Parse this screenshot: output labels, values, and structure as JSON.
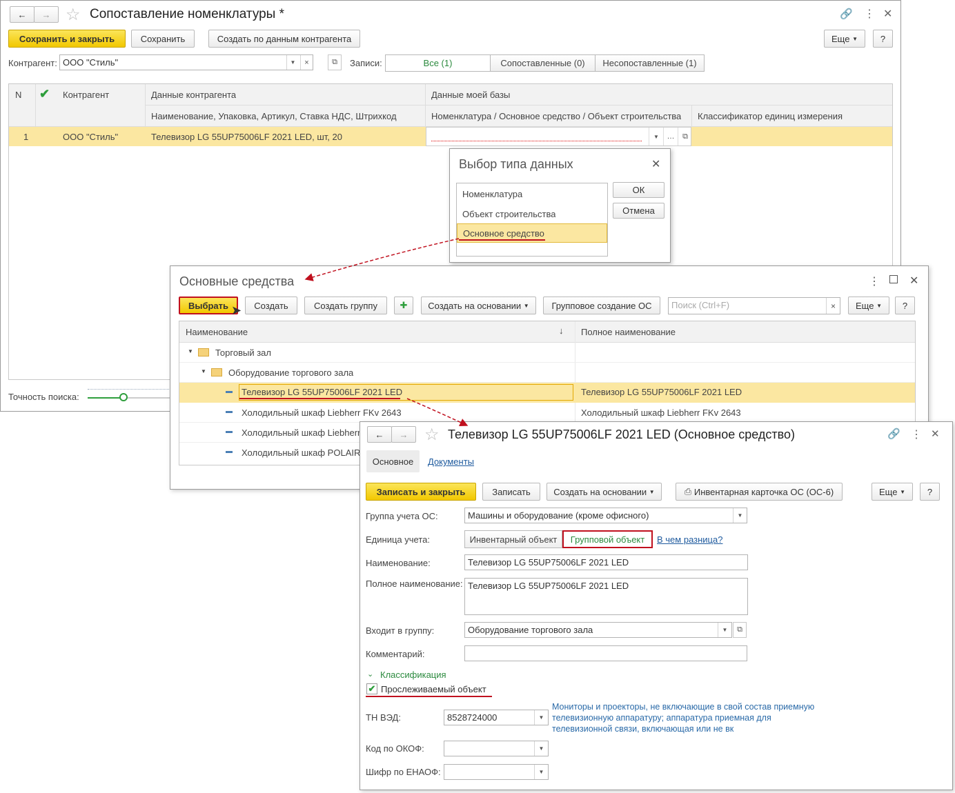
{
  "w1": {
    "title": "Сопоставление номенклатуры *",
    "btn_save_close": "Сохранить и закрыть",
    "btn_save": "Сохранить",
    "btn_create_by": "Создать по данным контрагента",
    "btn_more": "Еще",
    "btn_help": "?",
    "counterparty_label": "Контрагент:",
    "counterparty_value": "ООО \"Стиль\"",
    "records_label": "Записи:",
    "filter_all": "Все (1)",
    "filter_matched": "Сопоставленные (0)",
    "filter_unmatched": "Несопоставленные (1)",
    "grid": {
      "col_n": "N",
      "col_counterparty": "Контрагент",
      "col_cp_data": "Данные контрагента",
      "col_cp_sub": "Наименование, Упаковка, Артикул, Ставка НДС, Штрихкод",
      "col_my_data": "Данные моей базы",
      "col_my_sub": "Номенклатура / Основное средство / Объект строительства",
      "col_unit": "Классификатор единиц измерения",
      "row_n": "1",
      "row_cp": "ООО \"Стиль\"",
      "row_cp_data": "Телевизор LG 55UP75006LF 2021 LED, шт, 20"
    },
    "search_precision_label": "Точность поиска:"
  },
  "dlg": {
    "title": "Выбор типа данных",
    "items": [
      "Номенклатура",
      "Объект строительства",
      "Основное средство"
    ],
    "ok": "ОК",
    "cancel": "Отмена"
  },
  "w2": {
    "title": "Основные средства",
    "btn_select": "Выбрать",
    "btn_create": "Создать",
    "btn_create_group": "Создать группу",
    "btn_create_based": "Создать на основании",
    "btn_group_create": "Групповое создание ОС",
    "search_placeholder": "Поиск (Ctrl+F)",
    "btn_more": "Еще",
    "btn_help": "?",
    "col_name": "Наименование",
    "col_fullname": "Полное наименование",
    "rows": [
      {
        "name": "Торговый зал",
        "full": ""
      },
      {
        "name": "Оборудование торгового зала",
        "full": ""
      },
      {
        "name": "Телевизор LG 55UP75006LF 2021 LED",
        "full": "Телевизор LG 55UP75006LF 2021 LED"
      },
      {
        "name": "Холодильный шкаф Liebherr FKv 2643",
        "full": "Холодильный шкаф Liebherr FKv 2643"
      },
      {
        "name": "Холодильный шкаф Liebherr",
        "full": ""
      },
      {
        "name": "Холодильный шкаф POLAIR",
        "full": ""
      }
    ]
  },
  "w3": {
    "title": "Телевизор LG 55UP75006LF 2021 LED (Основное средство)",
    "tab_main": "Основное",
    "tab_docs": "Документы",
    "btn_write_close": "Записать и закрыть",
    "btn_write": "Записать",
    "btn_create_based": "Создать на основании",
    "btn_inv_card": "Инвентарная карточка ОС (ОС-6)",
    "btn_more": "Еще",
    "btn_help": "?",
    "group_label": "Группа учета ОС:",
    "group_value": "Машины и оборудование (кроме офисного)",
    "unit_label": "Единица учета:",
    "unit_inventory": "Инвентарный объект",
    "unit_group": "Групповой объект",
    "unit_diff_link": "В чем разница?",
    "name_label": "Наименование:",
    "name_value": "Телевизор LG 55UP75006LF 2021 LED",
    "fullname_label": "Полное наименование:",
    "fullname_value": "Телевизор LG 55UP75006LF 2021 LED",
    "parent_label": "Входит в группу:",
    "parent_value": "Оборудование торгового зала",
    "comment_label": "Комментарий:",
    "comment_value": "",
    "classification": "Классификация",
    "tracked_label": "Прослеживаемый объект",
    "tnved_label": "ТН ВЭД:",
    "tnved_value": "8528724000",
    "tnved_desc": "Мониторы и проекторы, не включающие в свой состав приемную телевизионную аппаратуру; аппаратура приемная для телевизионной связи, включающая или не вк",
    "okof_label": "Код по ОКОФ:",
    "enaof_label": "Шифр по ЕНАОФ:"
  }
}
